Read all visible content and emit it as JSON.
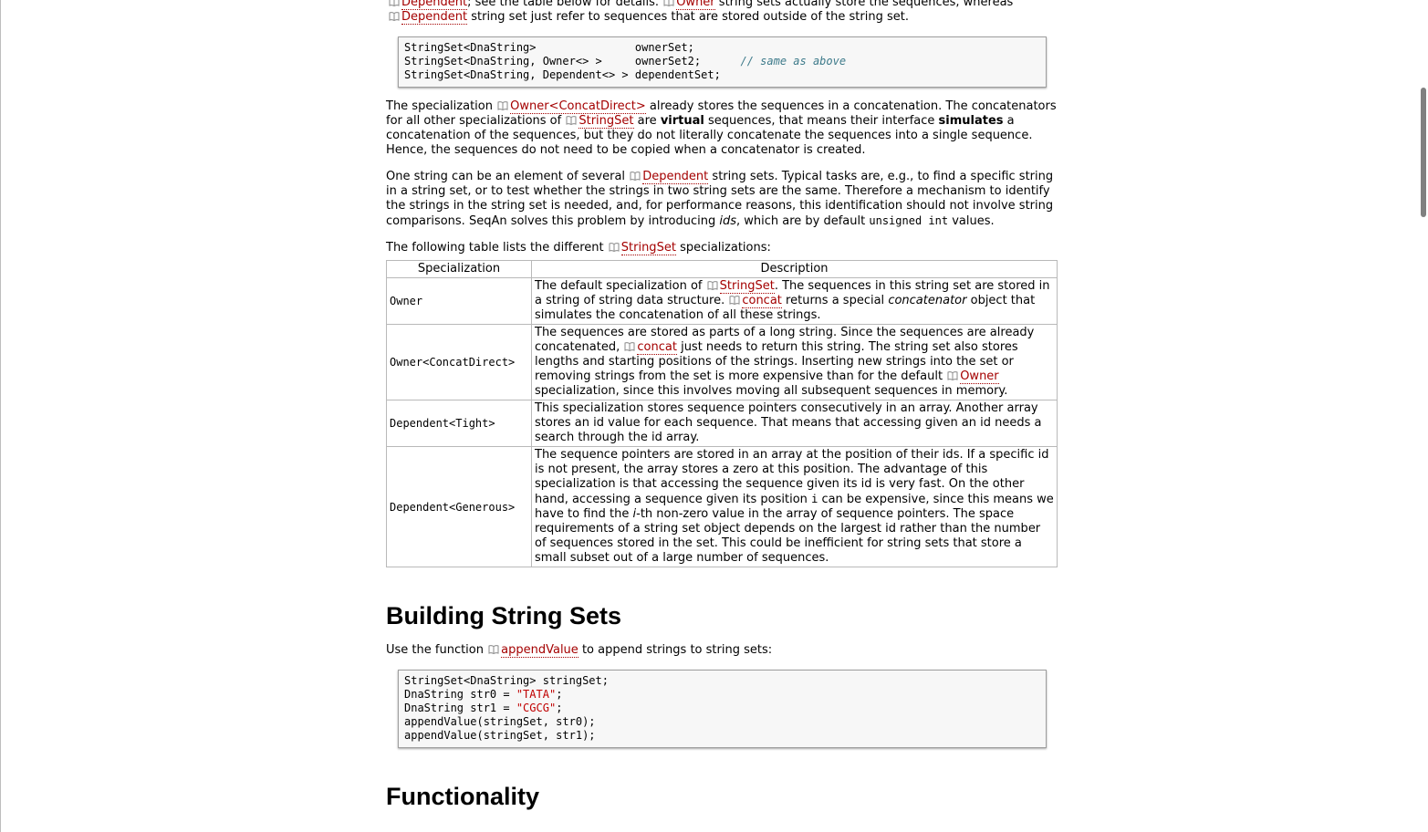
{
  "intro": {
    "line1_link1": "Dependent",
    "line1_text1": "; see the table below for details.",
    "line1_link2": "Owner",
    "line1_text2": "string sets actually store the sequences, whereas",
    "line2_link": "Dependent",
    "line2_text": "string set just refer to sequences that are stored outside of the string set."
  },
  "code1": {
    "l1a": "StringSet<DnaString>               ",
    "l1b": "ownerSet;",
    "l2a": "StringSet<DnaString, Owner<> >     ",
    "l2b": "ownerSet2;      ",
    "l2c": "// same as above",
    "l3a": "StringSet<DnaString, Dependent<> > ",
    "l3b": "dependentSet;"
  },
  "para1": {
    "t1": "The specialization",
    "link1": "Owner<ConcatDirect>",
    "t2": "already stores the sequences in a concatenation. The concatenators for all other specializations of",
    "link2": "StringSet",
    "t3": "are",
    "b1": "virtual",
    "t4": "sequences, that means their interface",
    "b2": "simulates",
    "t5": "a concatenation of the sequences, but they do not literally concatenate the sequences into a single sequence. Hence, the sequences do not need to be copied when a concatenator is created."
  },
  "para2": {
    "t1": "One string can be an element of several",
    "link1": "Dependent",
    "t2": "string sets. Typical tasks are, e.g., to find a specific string in a string set, or to test whether the strings in two string sets are the same. Therefore a mechanism to identify the strings in the string set is needed, and, for performance reasons, this identification should not involve string comparisons. SeqAn solves this problem by introducing",
    "i1": "ids",
    "t3": ", which are by default",
    "c1": "unsigned int",
    "t4": "values."
  },
  "para3": {
    "t1": "The following table lists the different",
    "link1": "StringSet",
    "t2": "specializations:"
  },
  "table": {
    "headers": [
      "Specialization",
      "Description"
    ],
    "rows": [
      {
        "name": "Owner",
        "t1": "The default specialization of",
        "link1": "StringSet",
        "t2": ". The sequences in this string set are stored in a string of string data structure.",
        "link2": "concat",
        "t3": "returns a special",
        "i1": "concatenator",
        "t4": "object that simulates the concatenation of all these strings."
      },
      {
        "name": "Owner<ConcatDirect>",
        "t1": "The sequences are stored as parts of a long string. Since the sequences are already concatenated,",
        "link1": "concat",
        "t2": "just needs to return this string. The string set also stores lengths and starting positions of the strings. Inserting new strings into the set or removing strings from the set is more expensive than for the default",
        "link2": "Owner",
        "t3": "specialization, since this involves moving all subsequent sequences in memory."
      },
      {
        "name": "Dependent<Tight>",
        "t1": "This specialization stores sequence pointers consecutively in an array. Another array stores an id value for each sequence. That means that accessing given an id needs a search through the id array."
      },
      {
        "name": "Dependent<Generous>",
        "t1": "The sequence pointers are stored in an array at the position of their ids. If a specific id is not present, the array stores a zero at this position. The advantage of this specialization is that accessing the sequence given its id is very fast. On the other hand, accessing a sequence given its position",
        "c1": "i",
        "t2": "can be expensive, since this means we have to find the",
        "i1": "i",
        "t3": "-th non-zero value in the array of sequence pointers. The space requirements of a string set object depends on the largest id rather than the number of sequences stored in the set. This could be inefficient for string sets that store a small subset out of a large number of sequences."
      }
    ]
  },
  "section1": {
    "title": "Building String Sets",
    "t1": "Use the function",
    "link1": "appendValue",
    "t2": "to append strings to string sets:"
  },
  "code2": {
    "l1": "StringSet<DnaString> stringSet;",
    "l2a": "DnaString str0 = ",
    "l2b": "\"TATA\"",
    "l2c": ";",
    "l3a": "DnaString str1 = ",
    "l3b": "\"CGCG\"",
    "l3c": ";",
    "l4": "appendValue(stringSet, str0);",
    "l5": "appendValue(stringSet, str1);"
  },
  "section2": {
    "title": "Functionality"
  },
  "colors": {
    "link": "#a40000",
    "comment": "#3d7a8a",
    "string": "#c00000",
    "table_border": "#b9b9b9"
  },
  "icons": {
    "link_icon": "book-icon"
  }
}
